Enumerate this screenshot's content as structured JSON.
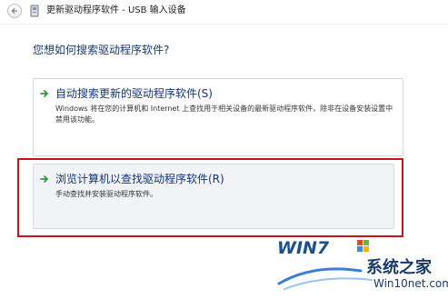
{
  "window": {
    "title": "更新驱动程序软件 - USB 输入设备"
  },
  "question": "您想如何搜索驱动程序软件?",
  "options": [
    {
      "title": "自动搜索更新的驱动程序软件(S)",
      "description": "Windows 将在您的计算机和 Internet 上查找用于相关设备的最新驱动程序软件，除非在设备安装设置中禁用该功能。"
    },
    {
      "title": "浏览计算机以查找驱动程序软件(R)",
      "description": "手动查找并安装驱动程序软件。"
    }
  ],
  "watermark": {
    "logo_text": "WIN7",
    "site_name": "系统之家",
    "url": "Win10net.com"
  },
  "colors": {
    "highlight": "#c8141c",
    "arrow": "#2f9a3a",
    "title_blue": "#13347a"
  }
}
